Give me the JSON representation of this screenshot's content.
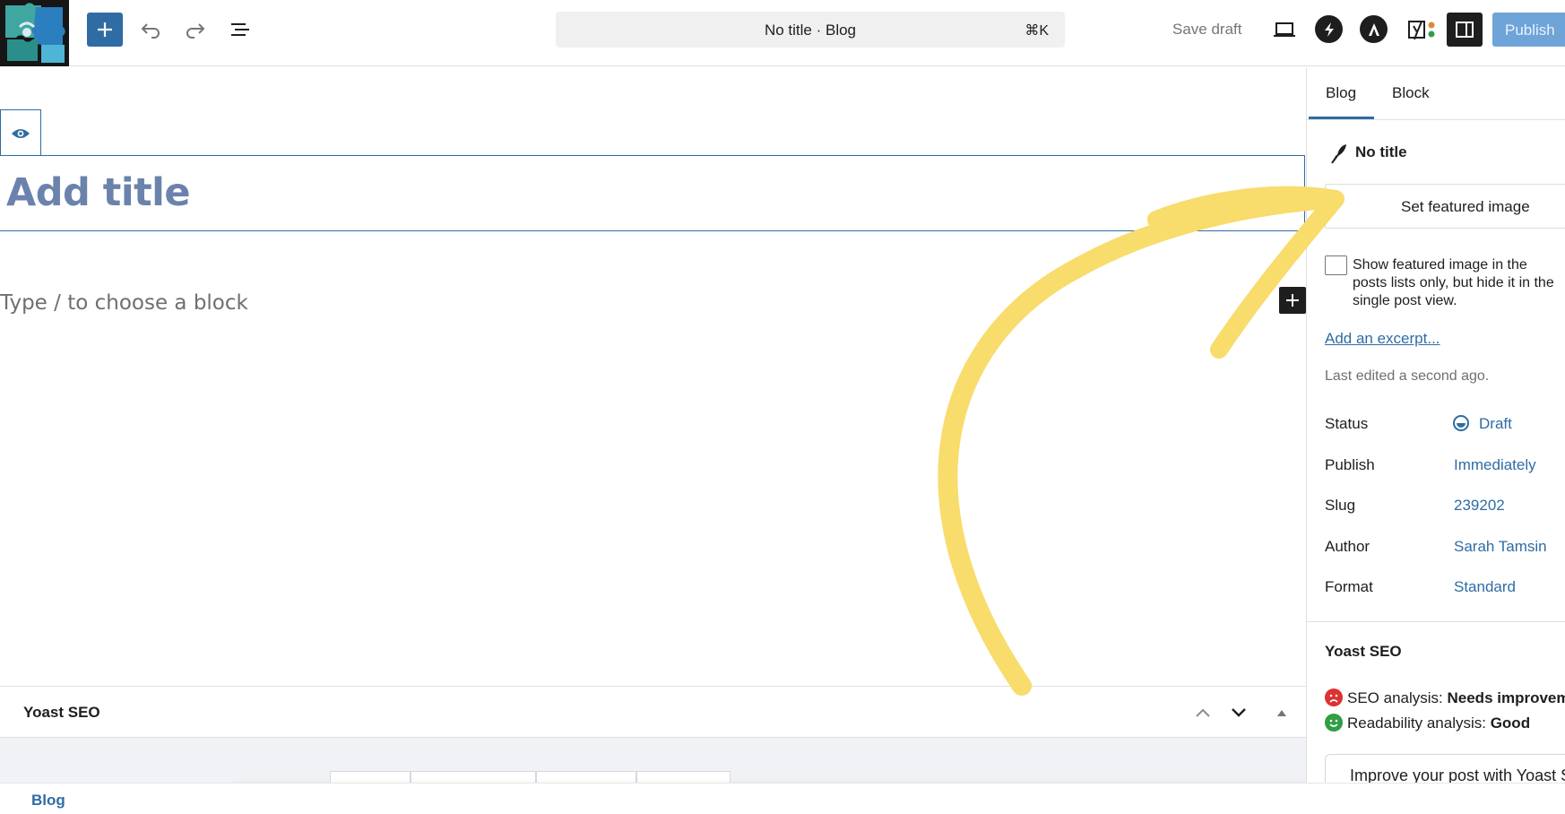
{
  "header": {
    "document_title": "No title · Blog",
    "command_shortcut": "⌘K",
    "save_draft_label": "Save draft",
    "publish_label": "Publish",
    "brand_accent": "#2f6ca4",
    "icons": [
      "add-block-icon",
      "undo-icon",
      "redo-icon",
      "document-overview-icon",
      "preview-icon",
      "jetpack-bolt-icon",
      "astra-icon",
      "yoast-icon",
      "settings-panel-icon"
    ]
  },
  "editor": {
    "title_placeholder": "Add title",
    "block_placeholder": "Type / to choose a block"
  },
  "metabox": {
    "title": "Yoast SEO"
  },
  "footer": {
    "breadcrumb": "Blog"
  },
  "sidebar": {
    "tabs": [
      {
        "label": "Blog",
        "active": true
      },
      {
        "label": "Block",
        "active": false
      }
    ],
    "post_title": "No title",
    "featured_image_button": "Set featured image",
    "featured_checkbox_label": "Show featured image in the posts lists only, but hide it in the single post view.",
    "featured_checkbox_checked": false,
    "excerpt_link": "Add an excerpt...",
    "last_edited": "Last edited a second ago.",
    "rows": [
      {
        "label": "Status",
        "value": "Draft"
      },
      {
        "label": "Publish",
        "value": "Immediately"
      },
      {
        "label": "Slug",
        "value": "239202"
      },
      {
        "label": "Author",
        "value": "Sarah Tamsin"
      },
      {
        "label": "Format",
        "value": "Standard"
      }
    ],
    "yoast": {
      "heading": "Yoast SEO",
      "seo_label": "SEO analysis:",
      "seo_value": "Needs improvement",
      "seo_color": "#dc3232",
      "readability_label": "Readability analysis:",
      "readability_value": "Good",
      "readability_color": "#2f9e44",
      "improve_button": "Improve your post with Yoast SEO"
    }
  },
  "annotation": {
    "arrow_color": "#f8dc6c"
  }
}
